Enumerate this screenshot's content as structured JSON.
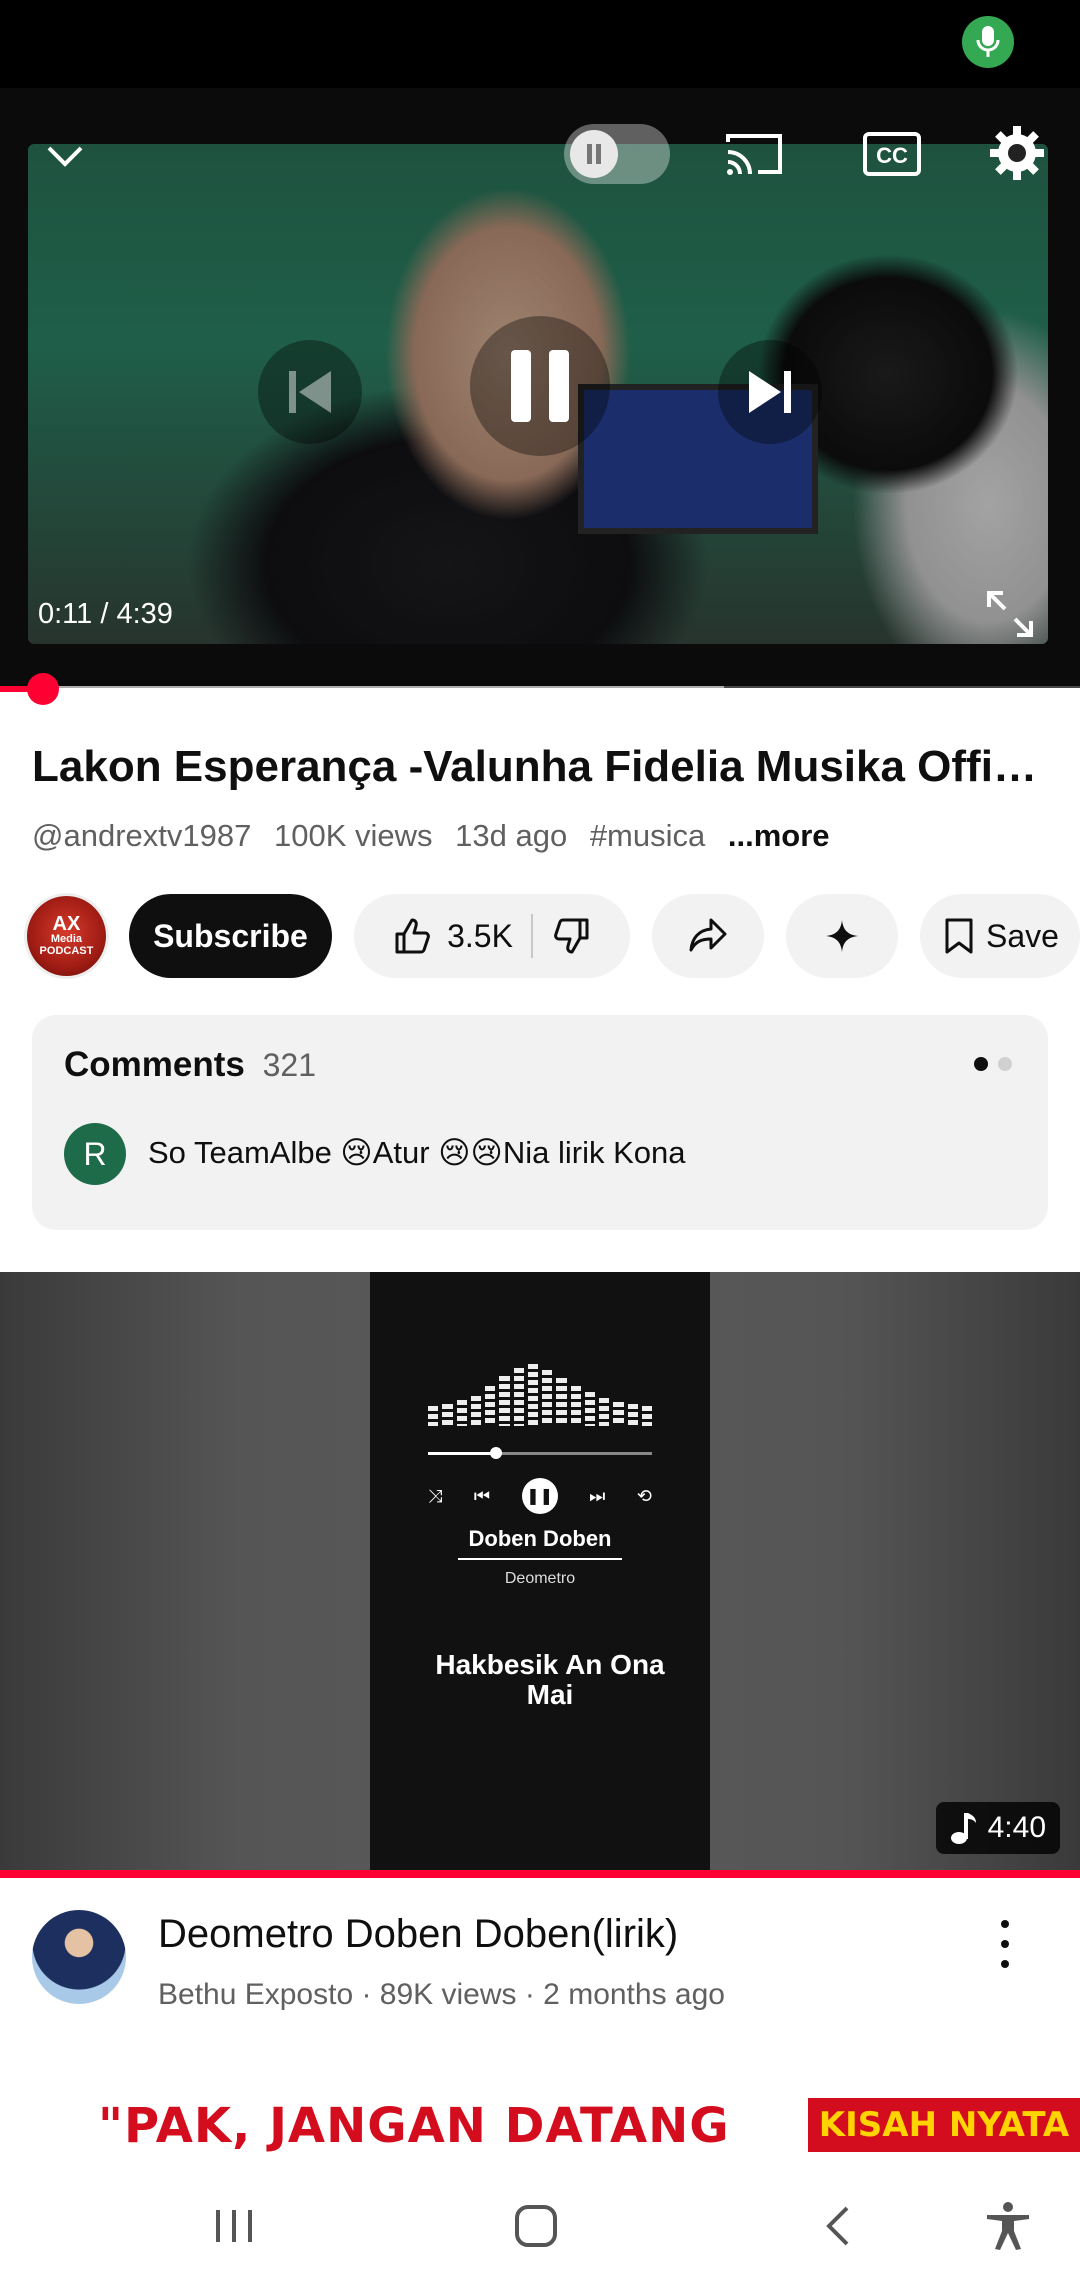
{
  "status_bar": {
    "mic_icon": "mic-icon"
  },
  "player": {
    "time": "0:11 / 4:39",
    "progress_fraction": 0.04,
    "buffered_fraction": 0.67,
    "icons": [
      "chevron-down-icon",
      "autoplay-toggle-icon",
      "cast-icon",
      "captions-icon",
      "settings-icon",
      "previous-icon",
      "pause-icon",
      "next-icon",
      "fullscreen-icon"
    ]
  },
  "video": {
    "title": "Lakon Esperança -Valunha Fidelia  Musika Official...",
    "channel_handle": "@andrextv1987",
    "views": "100K views",
    "age": "13d ago",
    "hashtag": "#musica",
    "more_label": "...more"
  },
  "channel": {
    "avatar_line1": "AX",
    "avatar_line2": "Media",
    "avatar_line3": "PODCAST"
  },
  "actions": {
    "subscribe_label": "Subscribe",
    "like_count": "3.5K",
    "save_label": "Save"
  },
  "comments": {
    "title": "Comments",
    "count": "321",
    "first_author_initial": "R",
    "first_comment": "So TeamAlbe 😢Atur 😢😢Nia lirik Kona"
  },
  "recommended": {
    "thumbnail": {
      "song": "Doben Doben",
      "artist": "Deometro",
      "lyric": "Hakbesik An Ona Mai",
      "duration": "4:40"
    },
    "title": "Deometro Doben Doben(lirik)",
    "meta": "Bethu Exposto · 89K views · 2 months ago"
  },
  "ad_banner": {
    "text": "\"PAK, JANGAN DATANG",
    "badge": "KISAH NYATA"
  },
  "nav_bar": {
    "icons": [
      "recent-apps-icon",
      "home-icon",
      "back-icon",
      "accessibility-icon"
    ]
  },
  "colors": {
    "accent_red": "#ff0033",
    "status_green": "#34a853"
  }
}
